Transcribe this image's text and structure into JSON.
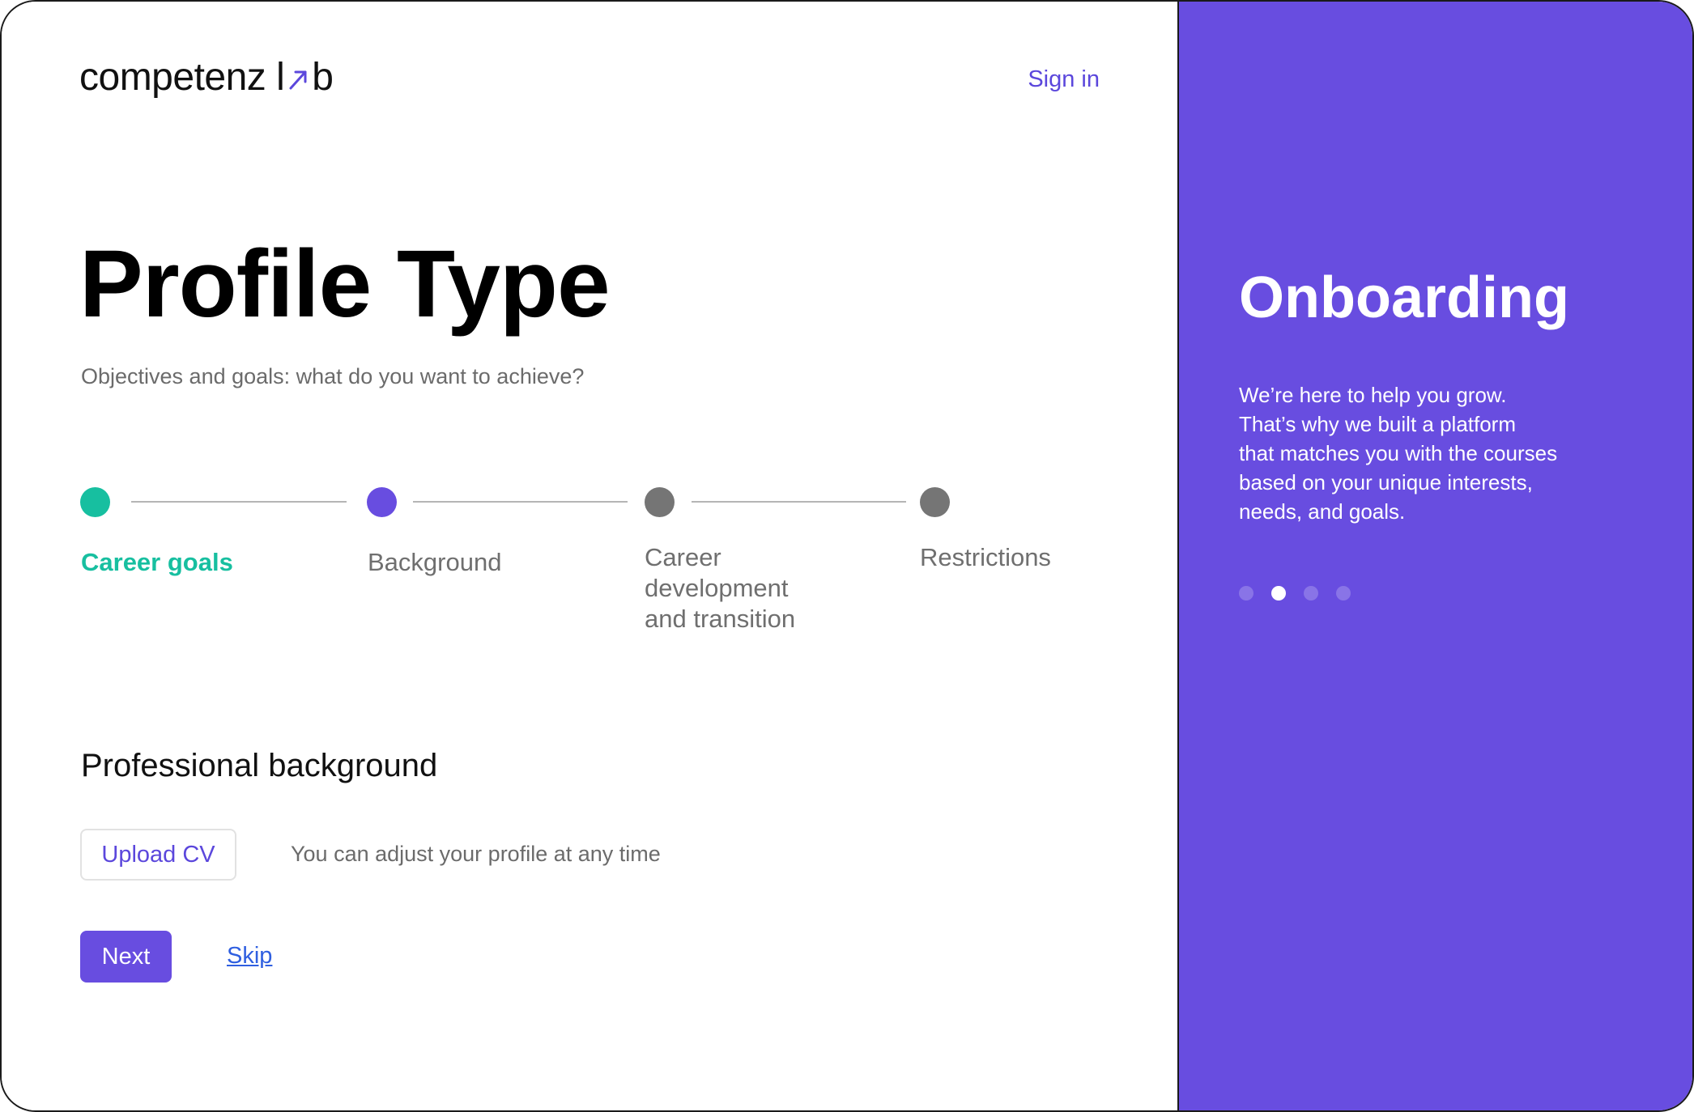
{
  "brand": {
    "logo_text_start": "competenz l",
    "logo_text_end": "b"
  },
  "header": {
    "signin_label": "Sign in"
  },
  "main": {
    "title": "Profile Type",
    "subtitle": "Objectives and goals: what do you want to achieve?",
    "steps": [
      {
        "label": "Career goals",
        "state": "active",
        "color": "#17bfa0"
      },
      {
        "label": "Background",
        "state": "current",
        "color": "#684de0"
      },
      {
        "label_lines": [
          "Career",
          "development",
          "and transition"
        ],
        "state": "inactive",
        "color": "#757575"
      },
      {
        "label": "Restrictions",
        "state": "inactive",
        "color": "#757575"
      }
    ],
    "section_title": "Professional background",
    "upload_label": "Upload CV",
    "hint": "You can adjust your profile at any time",
    "next_label": "Next",
    "skip_label": "Skip"
  },
  "onboarding": {
    "title": "Onboarding",
    "lines": [
      "We’re here to help you grow.",
      "That’s why we built a platform",
      "that matches you with the courses",
      "based on your unique interests,",
      "needs, and goals."
    ],
    "carousel": {
      "count": 4,
      "active_index": 1
    }
  },
  "colors": {
    "accent": "#684de0",
    "teal": "#17bfa0",
    "link": "#2f5fe0",
    "inactive": "#757575"
  }
}
